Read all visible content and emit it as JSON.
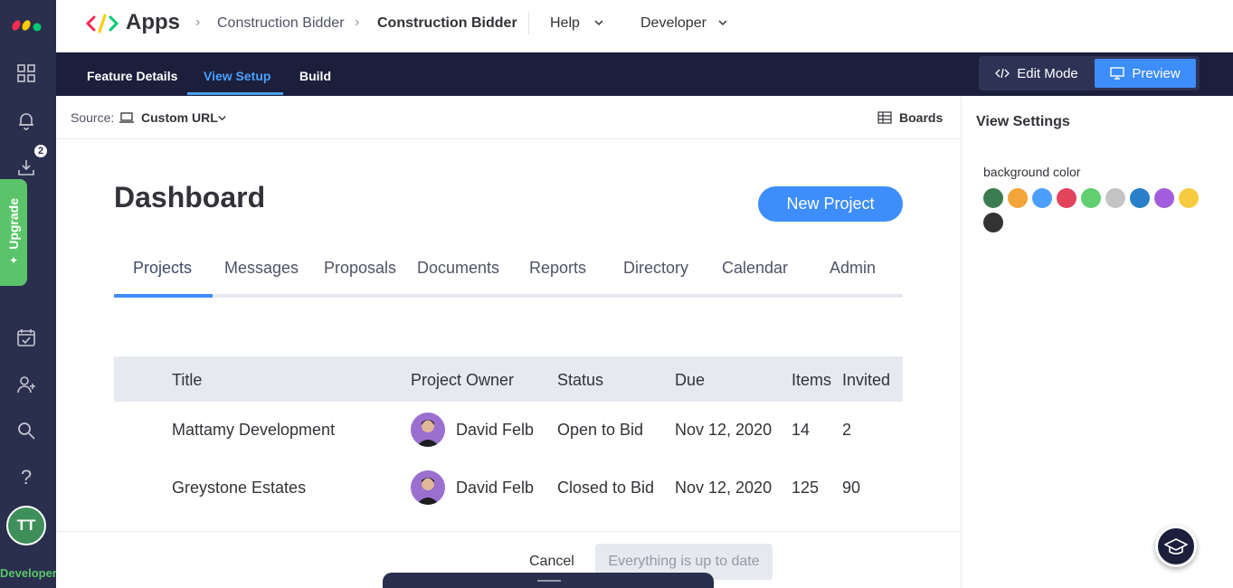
{
  "rail": {
    "icons": [
      "monday-logo",
      "grid-icon",
      "bell-icon",
      "download-icon",
      "calendar-check-icon",
      "add-person-icon",
      "search-icon",
      "help-icon"
    ],
    "download_badge": "2",
    "upgrade_label": "Upgrade",
    "avatar_initials": "TT",
    "avatar_color": "#3f8f5a",
    "developer_label": "Developer"
  },
  "topbar": {
    "app_name": "Apps",
    "breadcrumbs": [
      "Construction Bidder",
      "Construction Bidder"
    ],
    "menus": [
      "Help",
      "Developer"
    ]
  },
  "tabbar": {
    "tabs": [
      "Feature Details",
      "View Setup",
      "Build"
    ],
    "active_tab": "View Setup",
    "edit_mode_label": "Edit Mode",
    "preview_label": "Preview"
  },
  "source": {
    "label": "Source:",
    "value": "Custom URL",
    "boards_label": "Boards"
  },
  "view_settings": {
    "title": "View Settings",
    "background_label": "background color",
    "colors": [
      "#3b7d50",
      "#f3a53a",
      "#4c9ffe",
      "#e2445c",
      "#5fcf6f",
      "#c4c4c4",
      "#2a80c8",
      "#a25ddc",
      "#f6cb3f",
      "#333333"
    ]
  },
  "dashboard": {
    "title": "Dashboard",
    "new_project_label": "New Project",
    "tabs": [
      "Projects",
      "Messages",
      "Proposals",
      "Documents",
      "Reports",
      "Directory",
      "Calendar",
      "Admin"
    ],
    "active_tab": "Projects",
    "columns": [
      "Title",
      "Project Owner",
      "Status",
      "Due",
      "Items",
      "Invited"
    ],
    "rows": [
      {
        "title": "Mattamy Development",
        "owner": "David Felb",
        "status": "Open to Bid",
        "due": "Nov 12, 2020",
        "items": "14",
        "invited": "2"
      },
      {
        "title": "Greystone Estates",
        "owner": "David Felb",
        "status": "Closed to Bid",
        "due": "Nov 12, 2020",
        "items": "125",
        "invited": "90"
      }
    ]
  },
  "footer": {
    "cancel_label": "Cancel",
    "status_label": "Everything is up to date"
  }
}
